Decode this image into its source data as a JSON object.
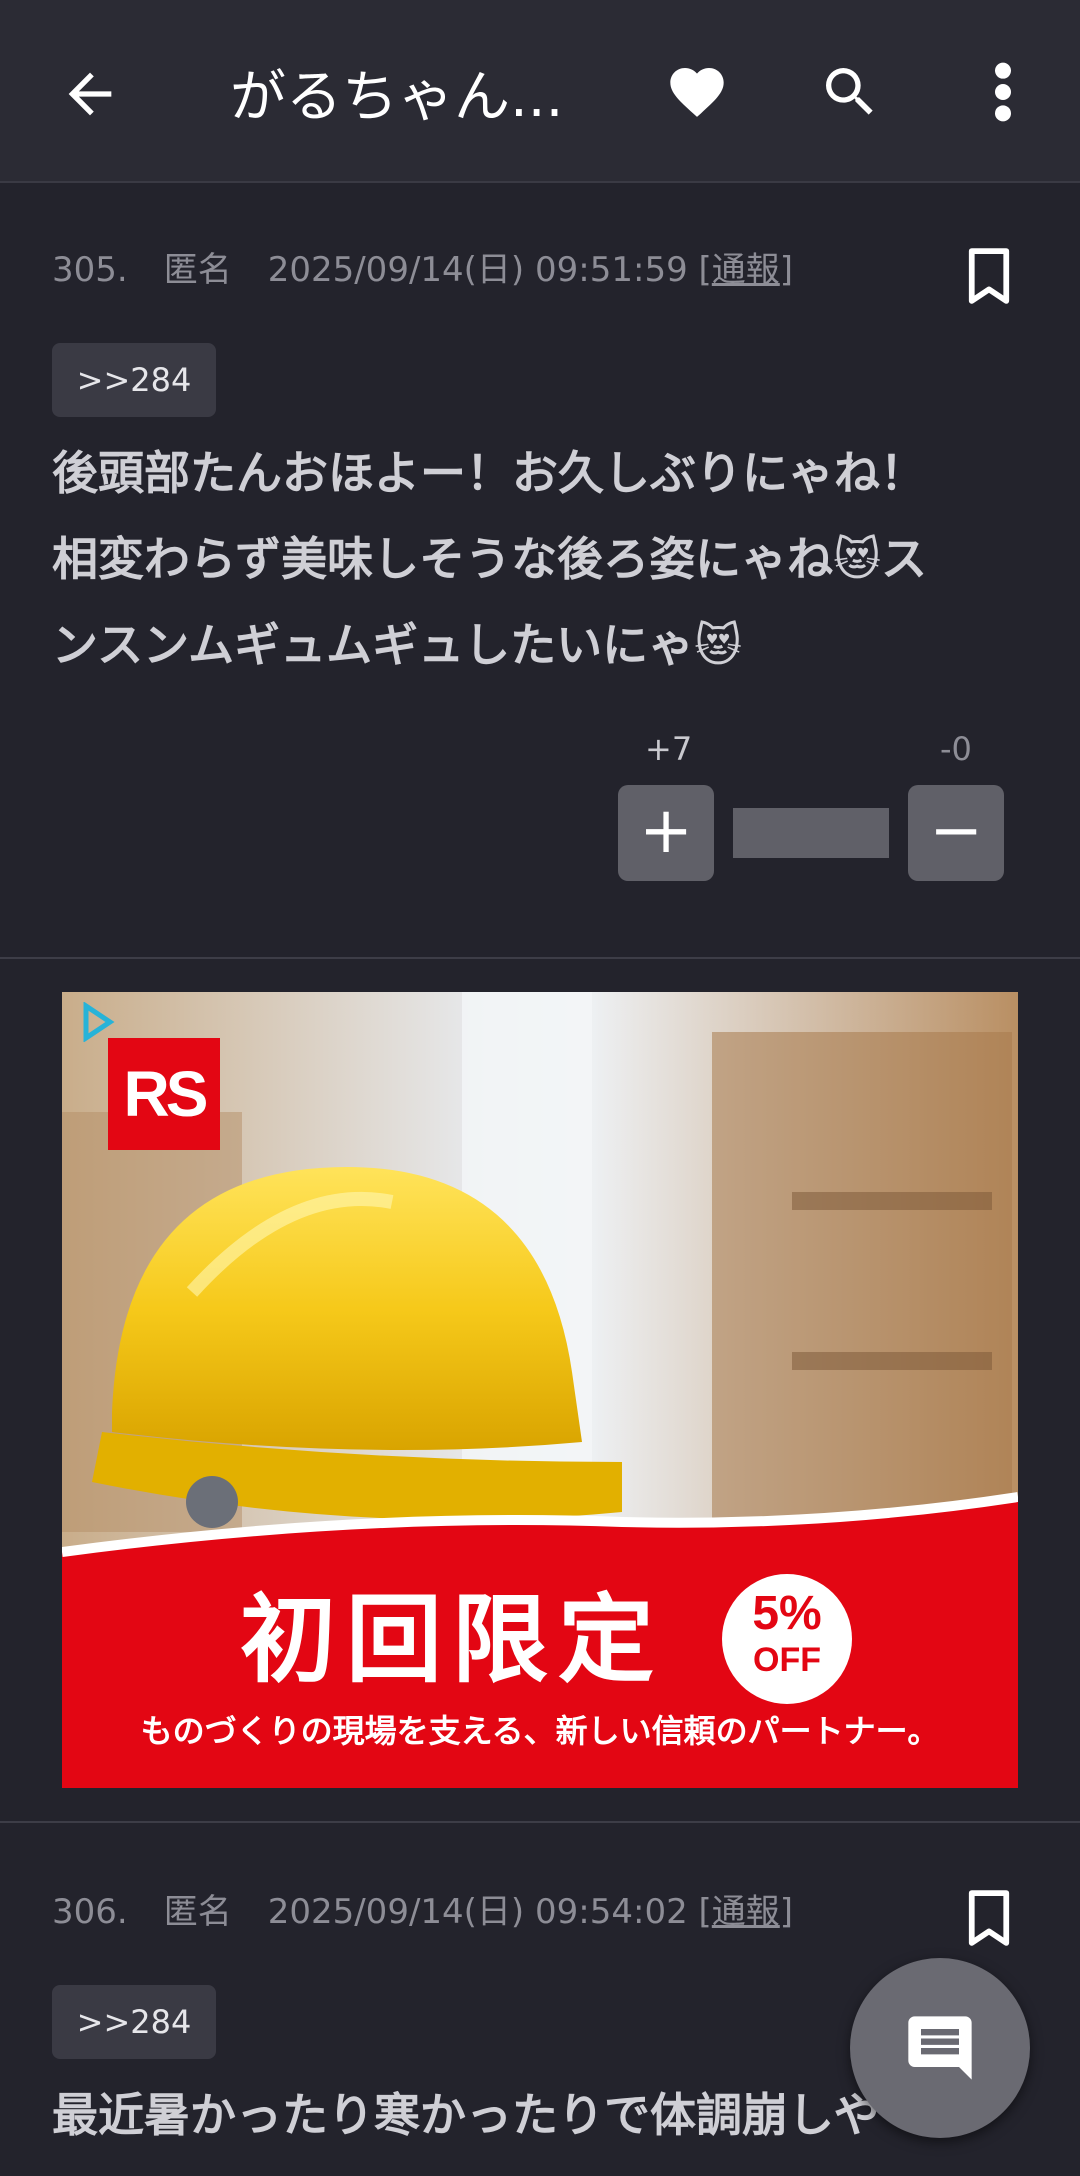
{
  "appbar": {
    "title": "がるちゃん..."
  },
  "posts": [
    {
      "number": "305.",
      "author": "匿名",
      "datetime": "2025/09/14(日) 09:51:59",
      "report_label": "通報",
      "reply_ref": ">>284",
      "body_lines": [
        "後頭部たんおほよー！お久しぶりにゃね！",
        "相変わらず美味しそうな後ろ姿にゃね😻ス",
        "ンスンムギュムギュしたいにゃ😻"
      ],
      "plus_votes": "+7",
      "minus_votes": "-0",
      "plus_label": "+",
      "minus_label": "−"
    },
    {
      "number": "306.",
      "author": "匿名",
      "datetime": "2025/09/14(日) 09:54:02",
      "report_label": "通報",
      "reply_ref": ">>284",
      "body_lines": [
        "最近暑かったり寒かったりで体調崩しや"
      ]
    }
  ],
  "ad": {
    "brand": "RS",
    "headline": "初回限定",
    "discount": "5%",
    "discount_suffix": "OFF",
    "tagline": "ものづくりの現場を支える、新しい信頼のパートナー。"
  },
  "icons": {
    "back": "arrow-left-icon",
    "favorite": "heart-icon",
    "search": "search-icon",
    "menu": "more-vert-icon",
    "bookmark": "bookmark-icon",
    "comment": "comment-icon"
  },
  "colors": {
    "background": "#23232c",
    "appbar": "#2b2b34",
    "ad_red": "#e30613",
    "helmet_yellow": "#f6c91a"
  }
}
